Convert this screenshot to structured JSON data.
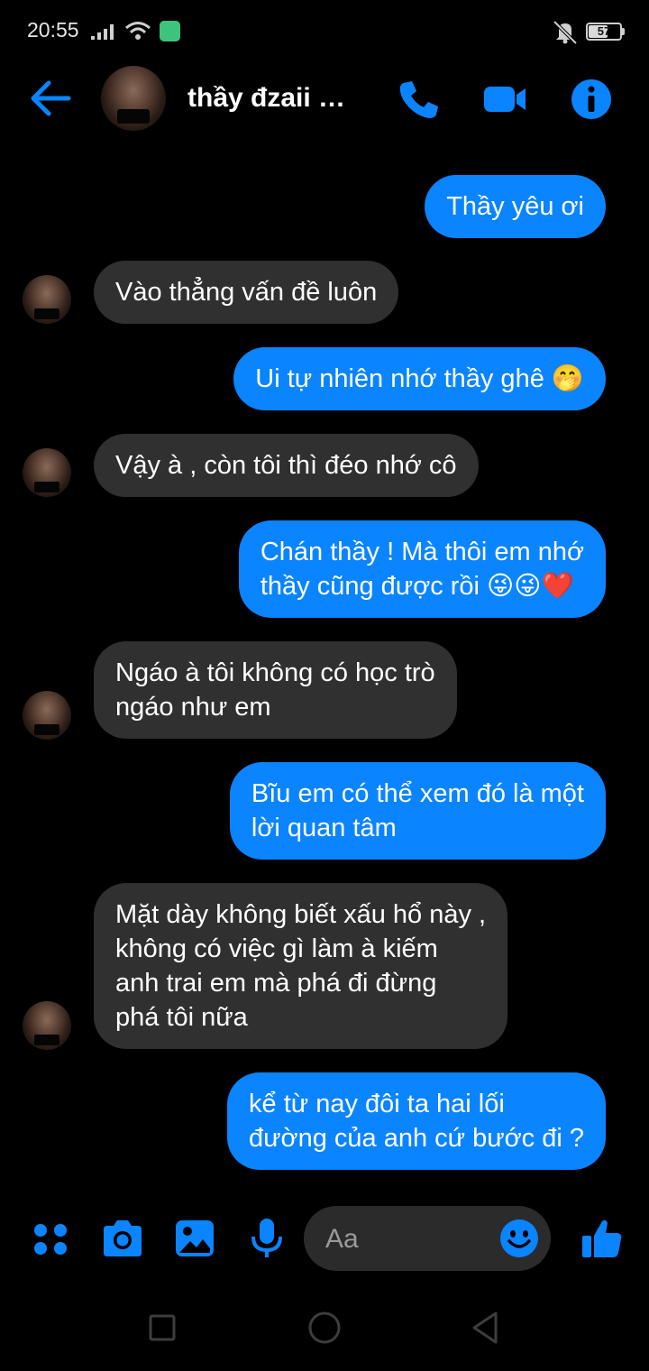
{
  "status_bar": {
    "time": "20:55",
    "battery": "57"
  },
  "header": {
    "contact_name": "thầy đzaii …",
    "icons": [
      "back-arrow-icon",
      "phone-icon",
      "video-camera-icon",
      "info-icon"
    ]
  },
  "messages": [
    {
      "direction": "out",
      "text": "Thầy yêu ơi"
    },
    {
      "direction": "in",
      "text": "Vào thẳng vấn đề luôn"
    },
    {
      "direction": "out",
      "text": "Ui tự nhiên nhớ thầy ghê 🤭"
    },
    {
      "direction": "in",
      "text": "Vậy à , còn tôi thì đéo nhớ cô"
    },
    {
      "direction": "out",
      "text": "Chán thầy ! Mà thôi em nhớ\nthầy cũng được rồi 😜😜❤️"
    },
    {
      "direction": "in",
      "text": "Ngáo à tôi không có học trò\nngáo như em"
    },
    {
      "direction": "out",
      "text": "Bĩu em có thể xem đó là một\nlời quan tâm"
    },
    {
      "direction": "in",
      "text": "Mặt dày không biết xấu hổ này ,\nkhông có việc gì làm à kiếm\nanh trai em mà phá đi đừng\nphá tôi nữa"
    },
    {
      "direction": "out",
      "text": "kể từ nay đôi ta hai lối\nđường của anh cứ bước đi ?"
    }
  ],
  "composer": {
    "placeholder": "Aa",
    "icons": [
      "apps-grid-icon",
      "camera-icon",
      "image-icon",
      "microphone-icon",
      "emoji-icon",
      "thumbs-up-icon"
    ]
  },
  "colors": {
    "accent": "#0a84ff",
    "incoming_bubble": "#303030",
    "background": "#000000"
  }
}
